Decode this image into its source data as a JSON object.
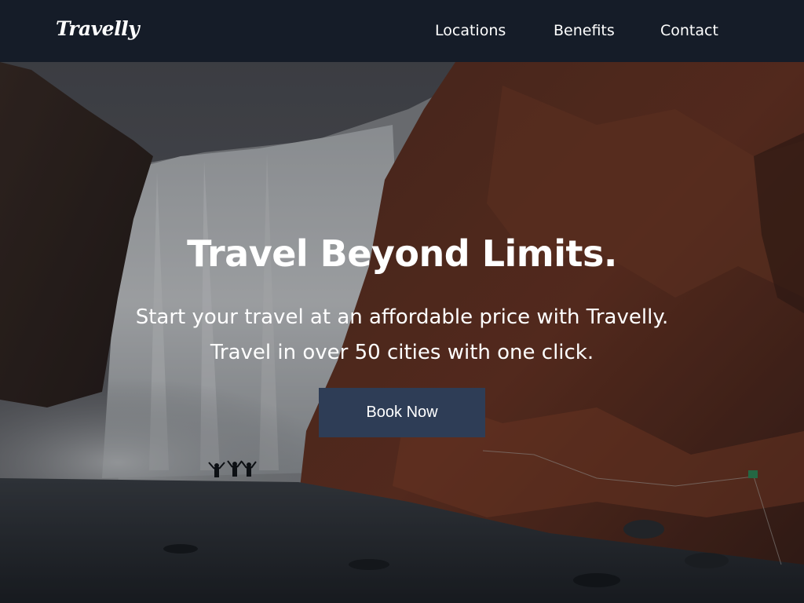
{
  "navbar": {
    "logo": "Travelly",
    "links": [
      {
        "label": "Locations"
      },
      {
        "label": "Benefits"
      },
      {
        "label": "Contact"
      }
    ]
  },
  "hero": {
    "title": "Travel Beyond Limits.",
    "subtitle_line1": "Start your travel at an affordable price with Travelly.",
    "subtitle_line2": "Travel in over 50 cities with one click.",
    "cta_label": "Book Now"
  },
  "colors": {
    "navbar_bg": "#151c28",
    "button_bg": "#2e3d56",
    "text": "#ffffff"
  }
}
